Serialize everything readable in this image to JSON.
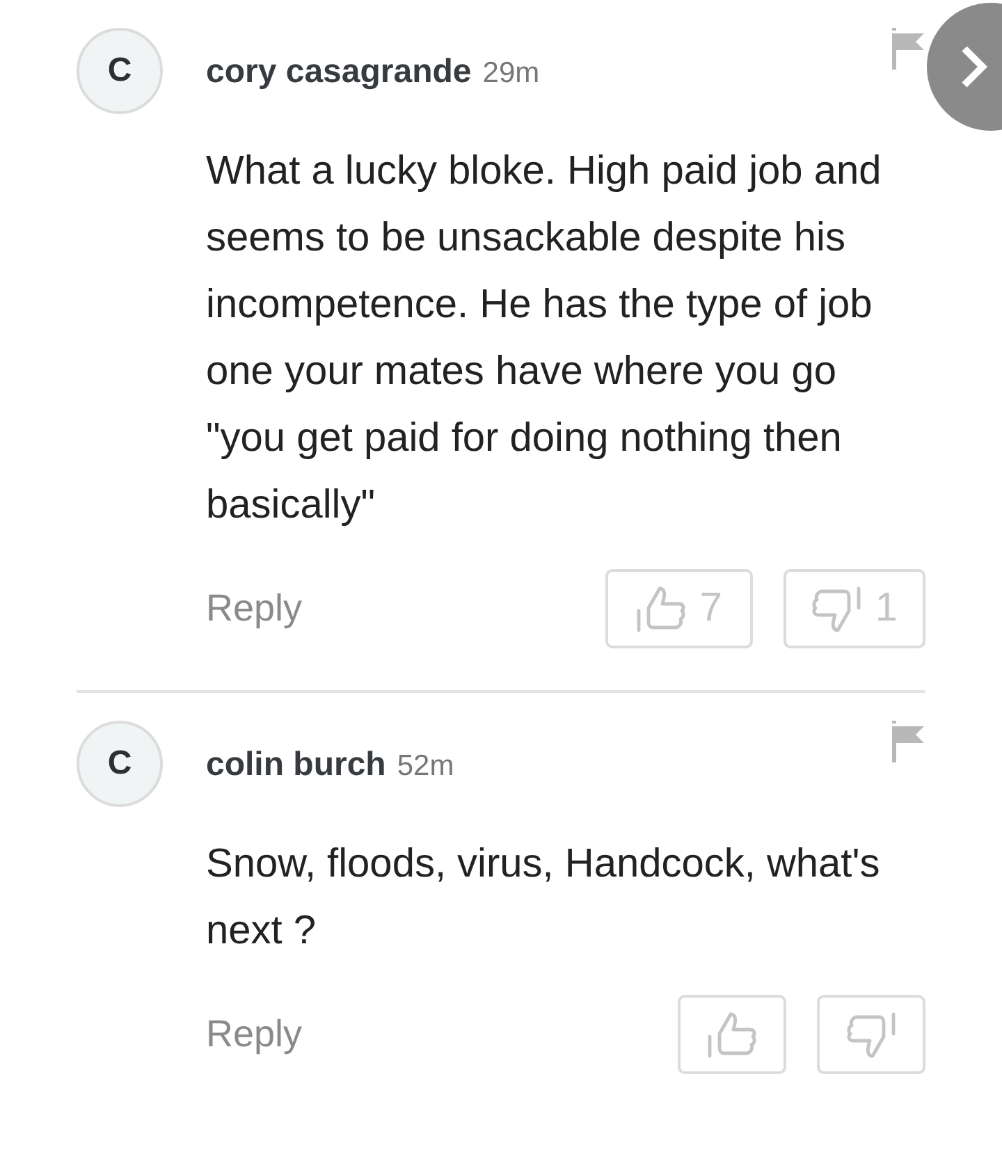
{
  "comments": [
    {
      "avatar": "C",
      "author": "cory casagrande",
      "time": "29m",
      "text": "What a lucky bloke. High paid job and seems to be unsackable despite his incompetence. He has the type of job one your mates have where you go \"you get paid for doing nothing then basically\"",
      "reply": "Reply",
      "likes": "7",
      "dislikes": "1"
    },
    {
      "avatar": "C",
      "author": "colin burch",
      "time": "52m",
      "text": "Snow, floods, virus, Handcock, what's next ?",
      "reply": "Reply"
    }
  ]
}
